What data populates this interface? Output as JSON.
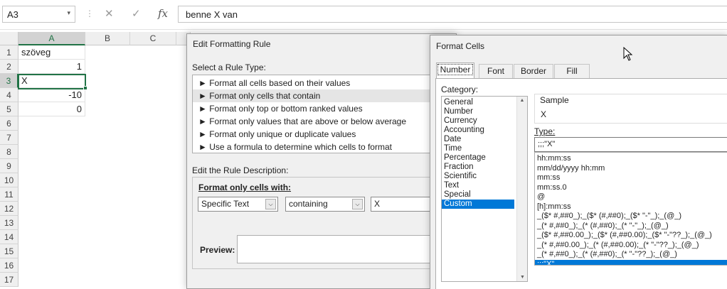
{
  "formula_bar": {
    "name_box": "A3",
    "name_box_arrow": "▾",
    "sep": "⋮",
    "cancel": "✕",
    "enter": "✓",
    "fx": "fx",
    "formula": "benne X van"
  },
  "sheet": {
    "columns": [
      "A",
      "B",
      "C"
    ],
    "rows": [
      "1",
      "2",
      "3",
      "4",
      "5",
      "6",
      "7",
      "8",
      "9",
      "10",
      "11",
      "12",
      "13",
      "14",
      "15",
      "16",
      "17"
    ],
    "cells": {
      "a1": "szöveg",
      "a2": "1",
      "a3": "X",
      "a4": "-10",
      "a5": "0"
    }
  },
  "edit_rule_dialog": {
    "title": "Edit Formatting Rule",
    "select_label": "Select a Rule Type:",
    "rule_types": [
      "► Format all cells based on their values",
      "► Format only cells that contain",
      "► Format only top or bottom ranked values",
      "► Format only values that are above or below average",
      "► Format only unique or duplicate values",
      "► Use a formula to determine which cells to format"
    ],
    "description_label": "Edit the Rule Description:",
    "format_with_label": "Format only cells with:",
    "condition_type": "Specific Text",
    "operator": "containing",
    "value": "X",
    "preview_label": "Preview:",
    "dropdown_arrow": "⌵"
  },
  "format_cells_dialog": {
    "title": "Format Cells",
    "tabs": [
      "Number",
      "Font",
      "Border",
      "Fill"
    ],
    "category_label": "Category:",
    "categories": [
      "General",
      "Number",
      "Currency",
      "Accounting",
      "Date",
      "Time",
      "Percentage",
      "Fraction",
      "Scientific",
      "Text",
      "Special",
      "Custom"
    ],
    "sample_label": "Sample",
    "sample_value": "X",
    "type_label": "Type:",
    "type_value": ";;;\"X\"",
    "type_list": [
      "hh:mm:ss",
      "mm/dd/yyyy hh:mm",
      "mm:ss",
      "mm:ss.0",
      "@",
      "[h]:mm:ss",
      "_($* #,##0_);_($* (#,##0);_($* \"-\"_);_(@_)",
      "_(* #,##0_);_(* (#,##0);_(* \"-\"_);_(@_)",
      "_($* #,##0.00_);_($* (#,##0.00);_($* \"-\"??_);_(@_)",
      "_(* #,##0.00_);_(* (#,##0.00);_(* \"-\"??_);_(@_)",
      "_(* #,##0_);_(* (#,##0);_(* \"-\"??_);_(@_)",
      ";;;\"X\""
    ],
    "scroll_up": "▲",
    "scroll_down": "▼"
  },
  "colors": {
    "excel_green": "#217346",
    "selection_blue": "#0078d7"
  }
}
